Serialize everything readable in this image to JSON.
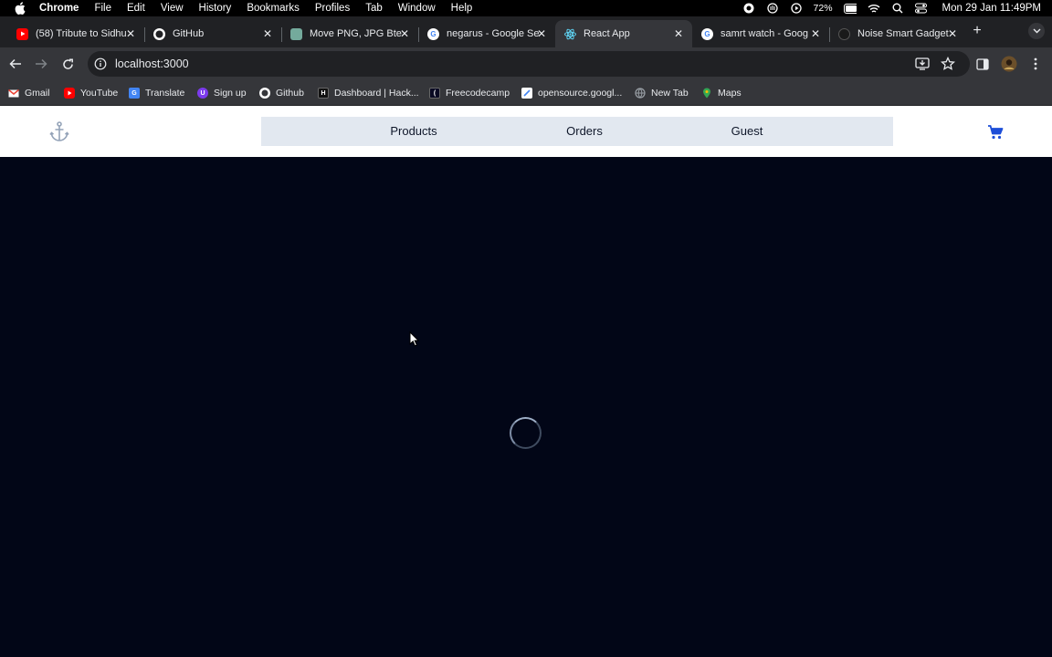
{
  "menubar": {
    "app_name": "Chrome",
    "items": [
      "File",
      "Edit",
      "View",
      "History",
      "Bookmarks",
      "Profiles",
      "Tab",
      "Window",
      "Help"
    ],
    "battery": "72%",
    "clock": "Mon 29 Jan  11:49PM"
  },
  "tabs": [
    {
      "title": "(58) Tribute to Sidhu",
      "icon": "youtube-icon",
      "color": "#ff0000"
    },
    {
      "title": "GitHub",
      "icon": "github-icon",
      "color": "#ffffff"
    },
    {
      "title": "Move PNG, JPG Bte",
      "icon": "chatgpt-icon",
      "color": "#74aa9c"
    },
    {
      "title": "negarus - Google Se",
      "icon": "google-icon",
      "color": "#ffffff"
    },
    {
      "title": "React App",
      "icon": "react-icon",
      "color": "#61dafb",
      "active": true
    },
    {
      "title": "samrt watch - Goog",
      "icon": "google-icon",
      "color": "#ffffff"
    },
    {
      "title": "Noise Smart Gadget",
      "icon": "noise-icon",
      "color": "#1a1a1a"
    }
  ],
  "address_bar": {
    "url": "localhost:3000"
  },
  "bookmarks": [
    {
      "label": "Gmail",
      "icon": "gmail-icon",
      "color": "#ea4335"
    },
    {
      "label": "YouTube",
      "icon": "youtube-icon",
      "color": "#ff0000"
    },
    {
      "label": "Translate",
      "icon": "translate-icon",
      "color": "#4285f4"
    },
    {
      "label": "Sign up",
      "icon": "signup-icon",
      "color": "#7c3aed"
    },
    {
      "label": "Github",
      "icon": "github-icon",
      "color": "#ffffff"
    },
    {
      "label": "Dashboard | Hack...",
      "icon": "hackerrank-icon",
      "color": "#111111"
    },
    {
      "label": "Freecodecamp",
      "icon": "freecodecamp-icon",
      "color": "#0a0a23"
    },
    {
      "label": "opensource.googl...",
      "icon": "opensource-icon",
      "color": "#ffffff"
    },
    {
      "label": "New Tab",
      "icon": "globe-icon",
      "color": "#9aa0a6"
    },
    {
      "label": "Maps",
      "icon": "maps-icon",
      "color": "#34a853"
    }
  ],
  "app": {
    "nav": [
      "Products",
      "Orders",
      "Guest"
    ],
    "accent": "#1d4ed8",
    "background": "#020617"
  }
}
